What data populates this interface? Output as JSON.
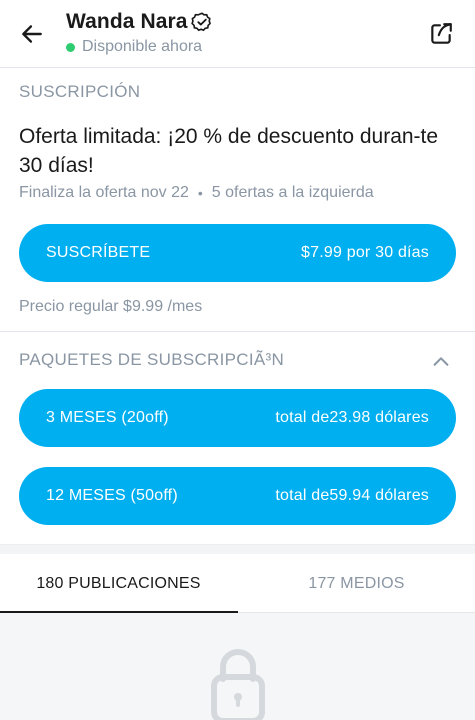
{
  "header": {
    "name": "Wanda Nara",
    "status": "Disponible ahora",
    "status_color": "#2ecc71",
    "icons": [
      "arrow-left-icon",
      "verified-badge-icon",
      "share-icon"
    ]
  },
  "subscription": {
    "section_label": "SUSCRIPCIÓN",
    "offer_title": "Oferta limitada: ¡20 % de descuento duran-te 30 días!",
    "offer_end": "Finaliza la oferta nov 22",
    "offers_left": "5 ofertas a la izquierda",
    "button_label": "SUSCRÍBETE",
    "button_price": "$7.99 por 30 días",
    "regular_price": "Precio regular $9.99 /mes"
  },
  "bundles": {
    "section_label": "PAQUETES DE SUBSCRIPCIÃ³N",
    "items": [
      {
        "label": "3 MESES (20off)",
        "price": "total de23.98 dólares"
      },
      {
        "label": "12 MESES (50off)",
        "price": "total de59.94 dólares"
      }
    ]
  },
  "tabs": {
    "posts": "180 PUBLICACIONES",
    "media": "177 MEDIOS",
    "active": "posts"
  },
  "colors": {
    "accent": "#00aff0",
    "muted_text": "#8a96a3",
    "text": "#1a1a1a"
  },
  "content": {
    "lock_icon": "lock-icon"
  }
}
